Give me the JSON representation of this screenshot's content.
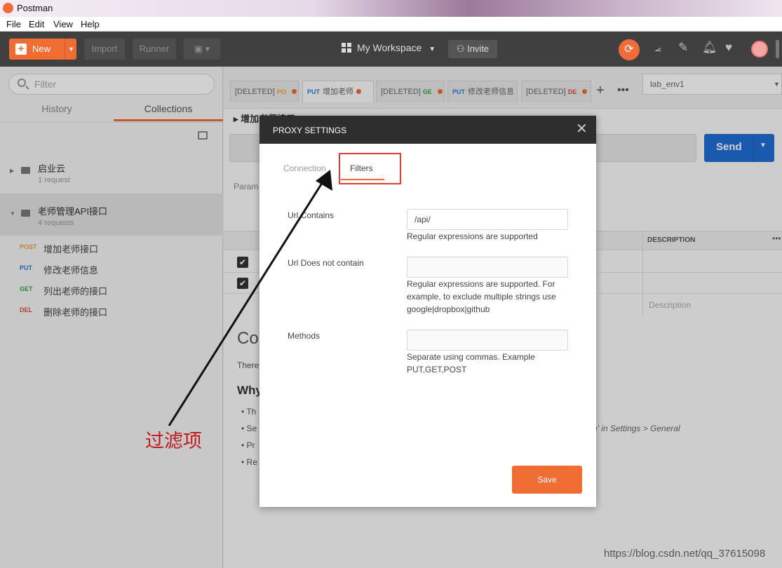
{
  "window": {
    "title": "Postman"
  },
  "menubar": [
    "File",
    "Edit",
    "View",
    "Help"
  ],
  "toolbar": {
    "new_label": "New",
    "import_label": "Import",
    "runner_label": "Runner",
    "workspace_label": "My Workspace",
    "invite_label": "Invite"
  },
  "sidebar": {
    "filter_placeholder": "Filter",
    "tabs": [
      "History",
      "Collections"
    ],
    "active_tab": "Collections",
    "collections": [
      {
        "name": "启业云",
        "count": "1 request"
      },
      {
        "name": "老师管理API接口",
        "count": "4 requests"
      }
    ],
    "requests": [
      {
        "method": "POST",
        "name": "增加老师接口",
        "color": "#e8a33c"
      },
      {
        "method": "PUT",
        "name": "修改老师信息",
        "color": "#2f7bd5"
      },
      {
        "method": "GET",
        "name": "列出老师的接口",
        "color": "#2fa34a"
      },
      {
        "method": "DEL",
        "name": "删除老师的接口",
        "color": "#e04a3c"
      }
    ]
  },
  "main": {
    "tabs": [
      {
        "prefix": "[DELETED]",
        "method": "PO",
        "name": "",
        "method_color": "#e8a33c"
      },
      {
        "prefix": "",
        "method": "PUT",
        "name": "增加老师",
        "method_color": "#2f7bd5"
      },
      {
        "prefix": "[DELETED]",
        "method": "GE",
        "name": "",
        "method_color": "#2fa34a"
      },
      {
        "prefix": "",
        "method": "PUT",
        "name": "修改老师信息",
        "method_color": "#2f7bd5"
      },
      {
        "prefix": "[DELETED]",
        "method": "DE",
        "name": "",
        "method_color": "#e04a3c"
      }
    ],
    "environment": "lab_env1",
    "request_title": "增加老师接口",
    "send_label": "Send",
    "params_label": "Param",
    "description_header": "DESCRIPTION",
    "description_placeholder": "Description",
    "bg_heading": "Co",
    "bg_text": "There",
    "bg_subheading": "Why",
    "bg_bullets": [
      "Th",
      "Se",
      "Pr",
      "Re"
    ],
    "bg_settings_text": "ication' in Settings > General"
  },
  "modal": {
    "title": "PROXY SETTINGS",
    "tabs": [
      "Connection",
      "Filters"
    ],
    "active_tab": "Filters",
    "fields": [
      {
        "label": "Url Contains",
        "value": "/api/",
        "placeholder": "",
        "help": "Regular expressions are supported"
      },
      {
        "label": "Url Does not contain",
        "value": "",
        "placeholder": "",
        "help": "Regular expressions are supported. For example, to exclude multiple strings use google|dropbox|github"
      },
      {
        "label": "Methods",
        "value": "",
        "placeholder": "",
        "help": "Separate using commas. Example PUT,GET,POST"
      }
    ],
    "save_label": "Save"
  },
  "annotation": {
    "label": "过滤项"
  },
  "watermark": "https://blog.csdn.net/qq_37615098",
  "colors": {
    "accent": "#ef6c33",
    "send": "#1f6ed4",
    "annotation": "#c0181b"
  }
}
